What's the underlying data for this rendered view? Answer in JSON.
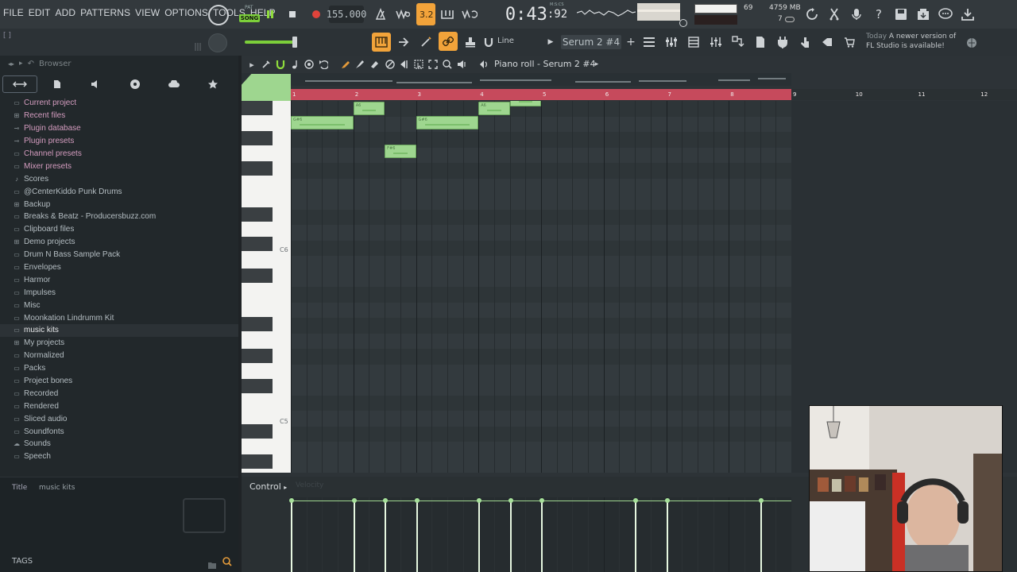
{
  "menu": [
    "FILE",
    "EDIT",
    "ADD",
    "PATTERNS",
    "VIEW",
    "OPTIONS",
    "TOOLS",
    "HELP"
  ],
  "transport": {
    "pat_label": "PAT",
    "song_label": "SONG",
    "tempo": "155.000",
    "time_main": "0:43",
    "time_sub": ":92",
    "time_mode": "M:S:CS"
  },
  "monitor": {
    "cpu": "69",
    "memory": "4759 MB",
    "polyphony": "7"
  },
  "hint_text": "[ ]",
  "snap_label": "Line",
  "pattern": "Serum 2 #4",
  "news": {
    "day": "Today",
    "text": "A newer version of FL Studio is available!"
  },
  "browser": {
    "title": "Browser",
    "items": [
      {
        "label": "Current project",
        "icon": "folder",
        "style": "pink"
      },
      {
        "label": "Recent files",
        "icon": "folder-plus",
        "style": "pink"
      },
      {
        "label": "Plugin database",
        "icon": "plug",
        "style": "pink"
      },
      {
        "label": "Plugin presets",
        "icon": "plug",
        "style": "pink"
      },
      {
        "label": "Channel presets",
        "icon": "folder",
        "style": "pink"
      },
      {
        "label": "Mixer presets",
        "icon": "folder",
        "style": "pink"
      },
      {
        "label": "Scores",
        "icon": "music",
        "style": ""
      },
      {
        "label": "@CenterKiddo Punk Drums",
        "icon": "folder",
        "style": ""
      },
      {
        "label": "Backup",
        "icon": "folder-plus",
        "style": ""
      },
      {
        "label": "Breaks & Beatz - Producersbuzz.com",
        "icon": "folder",
        "style": ""
      },
      {
        "label": "Clipboard files",
        "icon": "folder",
        "style": ""
      },
      {
        "label": "Demo projects",
        "icon": "folder-plus",
        "style": ""
      },
      {
        "label": "Drum N Bass Sample Pack",
        "icon": "folder",
        "style": ""
      },
      {
        "label": "Envelopes",
        "icon": "folder",
        "style": ""
      },
      {
        "label": "Harmor",
        "icon": "folder",
        "style": ""
      },
      {
        "label": "Impulses",
        "icon": "folder",
        "style": ""
      },
      {
        "label": "Misc",
        "icon": "folder",
        "style": ""
      },
      {
        "label": "Moonkation Lindrumm Kit",
        "icon": "folder",
        "style": ""
      },
      {
        "label": "music kits",
        "icon": "folder",
        "style": "hl"
      },
      {
        "label": "My projects",
        "icon": "folder-plus",
        "style": ""
      },
      {
        "label": "Normalized",
        "icon": "folder",
        "style": ""
      },
      {
        "label": "Packs",
        "icon": "folder",
        "style": ""
      },
      {
        "label": "Project bones",
        "icon": "folder",
        "style": ""
      },
      {
        "label": "Recorded",
        "icon": "folder",
        "style": ""
      },
      {
        "label": "Rendered",
        "icon": "folder",
        "style": ""
      },
      {
        "label": "Sliced audio",
        "icon": "folder",
        "style": ""
      },
      {
        "label": "Soundfonts",
        "icon": "folder",
        "style": ""
      },
      {
        "label": "Sounds",
        "icon": "cloud",
        "style": ""
      },
      {
        "label": "Speech",
        "icon": "folder",
        "style": ""
      }
    ],
    "footer_title": "Title",
    "footer_value": "music kits",
    "tags_label": "TAGS"
  },
  "piano_roll": {
    "title": "Piano roll - Serum 2 #4",
    "ruler_numbers": [
      "1",
      "2",
      "3",
      "4",
      "5",
      "6",
      "7",
      "8",
      "9",
      "10",
      "11",
      "12"
    ],
    "key_labels": [
      "C6",
      "C5"
    ],
    "control_label": "Control",
    "control_sub": "Velocity",
    "notes": [
      {
        "label": "G#6",
        "start": 1.0,
        "length": 1.0,
        "row": 2
      },
      {
        "label": "A6",
        "start": 2.0,
        "length": 0.5,
        "row": 1
      },
      {
        "label": "F#6",
        "start": 2.5,
        "length": 0.5,
        "row": 4
      },
      {
        "label": "G#6",
        "start": 3.0,
        "length": 1.0,
        "row": 2
      },
      {
        "label": "A6",
        "start": 4.0,
        "length": 0.5,
        "row": 1
      },
      {
        "label": "",
        "start": 4.5,
        "length": 0.5,
        "row": 0
      }
    ],
    "velocity_positions": [
      1.0,
      2.0,
      2.5,
      3.0,
      4.0,
      4.5,
      5.0,
      6.5,
      7.0,
      8.5
    ]
  },
  "colors": {
    "note": "#9ed68f",
    "loop": "#c64a5c",
    "accent": "#7ccf3a"
  }
}
